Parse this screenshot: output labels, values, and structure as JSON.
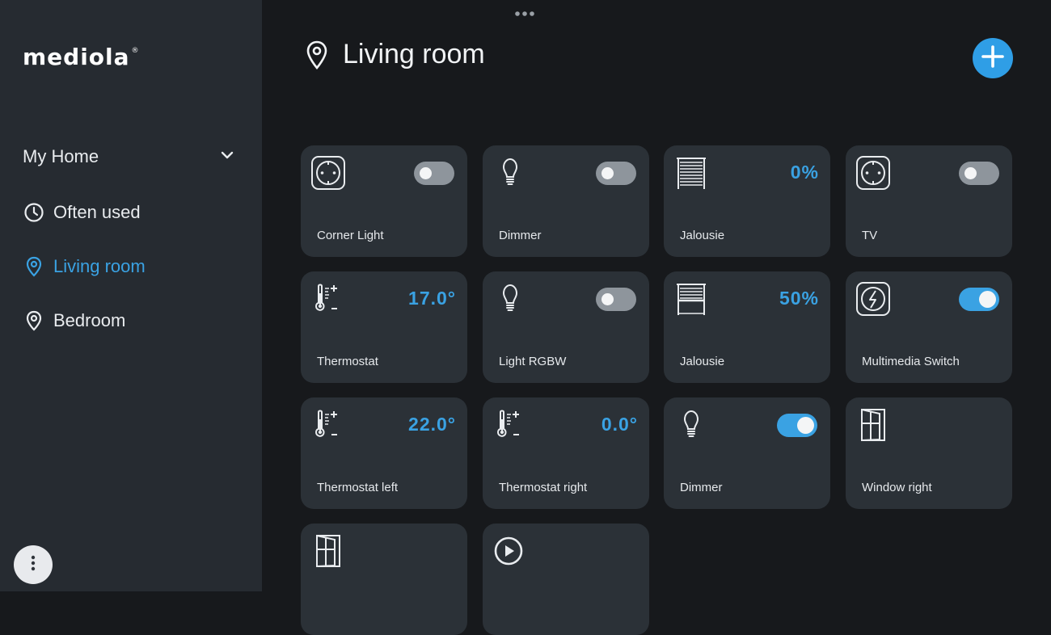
{
  "brand": {
    "logo_text": "mediola",
    "registered": "®"
  },
  "sidebar": {
    "home_label": "My Home",
    "items": [
      {
        "label": "Often used",
        "icon": "clock-icon",
        "active": false
      },
      {
        "label": "Living room",
        "icon": "location-pin-icon",
        "active": true
      },
      {
        "label": "Bedroom",
        "icon": "location-pin-icon",
        "active": false
      }
    ]
  },
  "header": {
    "title": "Living room",
    "icon": "location-pin-icon"
  },
  "colors": {
    "accent": "#3aa2e3",
    "sidebar_bg": "#262b31",
    "page_bg": "#17191c",
    "tile_bg": "#2b3137",
    "toggle_off": "#8e959c"
  },
  "tiles": [
    {
      "label": "Corner Light",
      "icon": "socket-icon",
      "control": "toggle",
      "state": "off"
    },
    {
      "label": "Dimmer",
      "icon": "lightbulb-icon",
      "control": "toggle",
      "state": "off"
    },
    {
      "label": "Jalousie",
      "icon": "blinds-closed-icon",
      "control": "value",
      "value": "0%"
    },
    {
      "label": "TV",
      "icon": "socket-icon",
      "control": "toggle",
      "state": "off"
    },
    {
      "label": "Thermostat",
      "icon": "thermometer-icon",
      "control": "value",
      "value": "17.0°"
    },
    {
      "label": "Light RGBW",
      "icon": "lightbulb-icon",
      "control": "toggle",
      "state": "off"
    },
    {
      "label": "Jalousie",
      "icon": "blinds-half-icon",
      "control": "value",
      "value": "50%"
    },
    {
      "label": "Multimedia Switch",
      "icon": "switch-socket-icon",
      "control": "toggle",
      "state": "on"
    },
    {
      "label": "Thermostat left",
      "icon": "thermometer-icon",
      "control": "value",
      "value": "22.0°"
    },
    {
      "label": "Thermostat right",
      "icon": "thermometer-icon",
      "control": "value",
      "value": "0.0°"
    },
    {
      "label": "Dimmer",
      "icon": "lightbulb-icon",
      "control": "toggle",
      "state": "on"
    },
    {
      "label": "Window right",
      "icon": "window-icon",
      "control": "none"
    },
    {
      "label": "",
      "icon": "window-icon",
      "control": "none"
    },
    {
      "label": "",
      "icon": "play-icon",
      "control": "none"
    }
  ]
}
